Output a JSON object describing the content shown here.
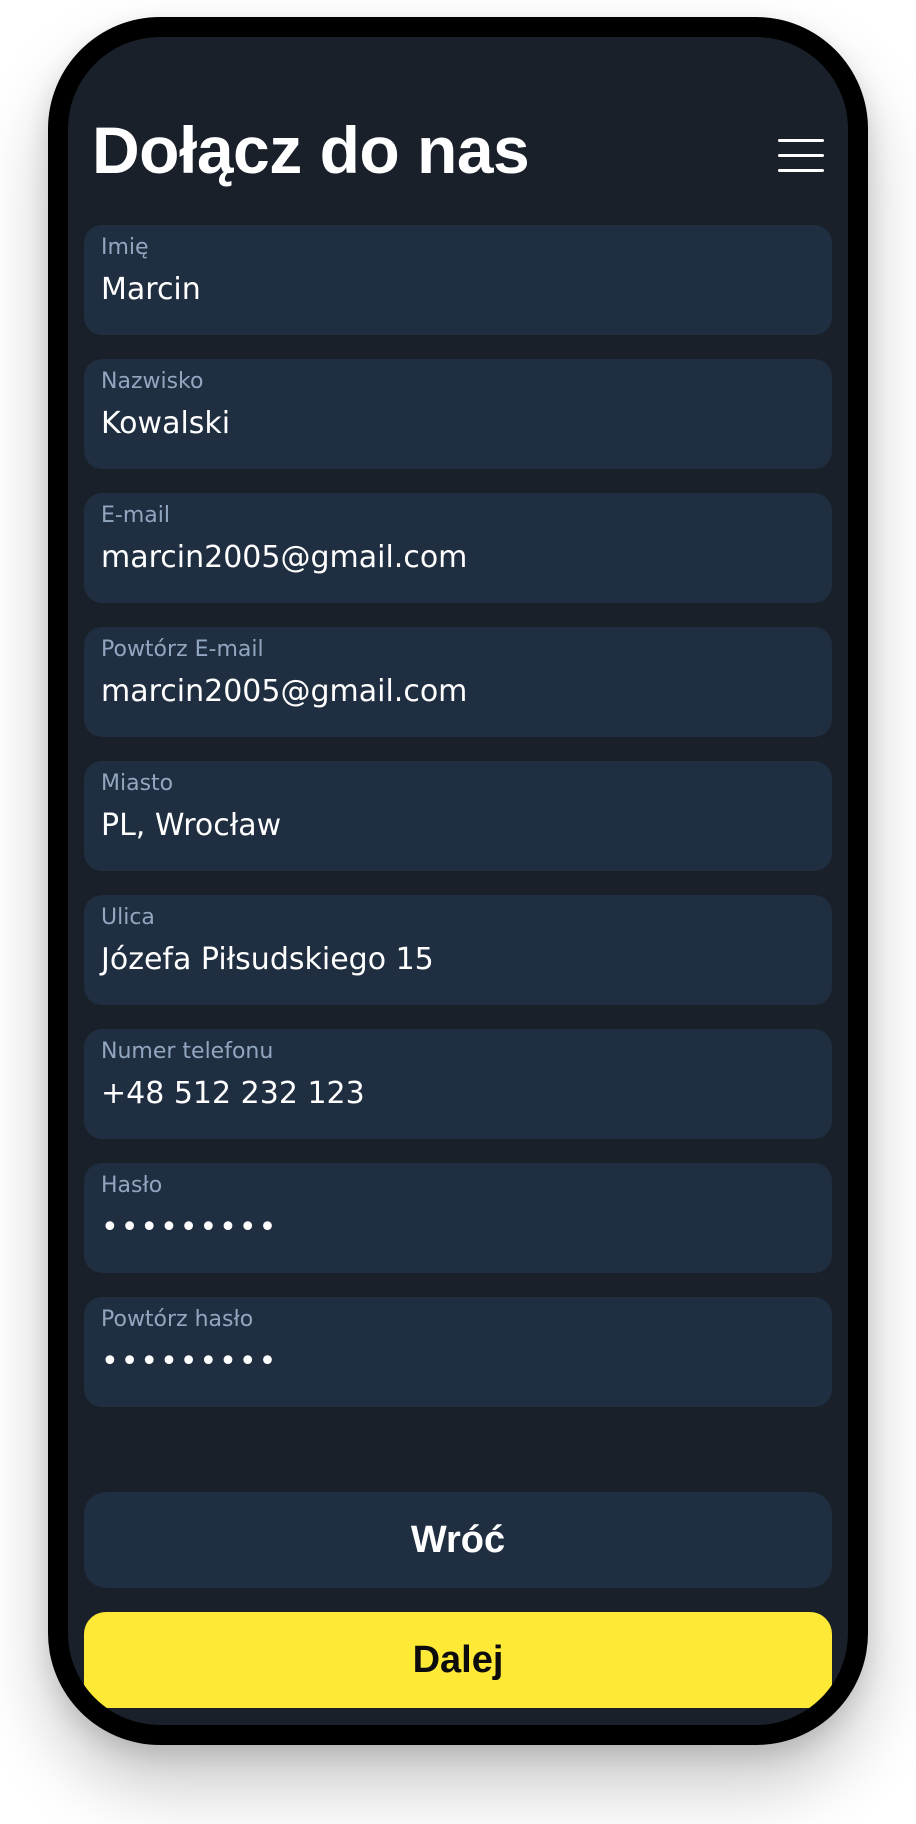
{
  "header": {
    "title": "Dołącz do nas",
    "menu_icon": "hamburger-menu-icon"
  },
  "form": {
    "fields": [
      {
        "label": "Imię",
        "value": "Marcin"
      },
      {
        "label": "Nazwisko",
        "value": "Kowalski"
      },
      {
        "label": "E-mail",
        "value": "marcin2005@gmail.com"
      },
      {
        "label": "Powtórz E-mail",
        "value": "marcin2005@gmail.com"
      },
      {
        "label": "Miasto",
        "value": "PL, Wrocław"
      },
      {
        "label": "Ulica",
        "value": "Józefa Piłsudskiego 15"
      },
      {
        "label": "Numer telefonu",
        "value": "+48 512 232 123"
      },
      {
        "label": "Hasło",
        "value": "•••••••••"
      },
      {
        "label": "Powtórz hasło",
        "value": "•••••••••"
      }
    ]
  },
  "actions": {
    "back_label": "Wróć",
    "next_label": "Dalej"
  },
  "colors": {
    "background": "#1a202a",
    "field_background": "#1f2e40",
    "label_text": "#93a6c0",
    "accent": "#fde936"
  }
}
